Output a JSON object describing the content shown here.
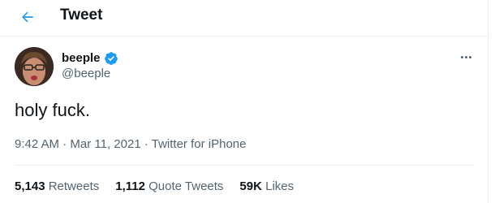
{
  "header": {
    "title": "Tweet",
    "back_icon": "arrow-left-icon"
  },
  "tweet": {
    "display_name": "beeple",
    "verified_icon": "verified-badge-icon",
    "handle": "@beeple",
    "text": "holy fuck.",
    "time": "9:42 AM",
    "separator": "·",
    "date": "Mar 11, 2021",
    "source": "Twitter for iPhone",
    "more_icon": "more-options-icon"
  },
  "stats": {
    "retweets_count": "5,143",
    "retweets_label": "Retweets",
    "quotes_count": "1,112",
    "quotes_label": "Quote Tweets",
    "likes_count": "59K",
    "likes_label": "Likes"
  },
  "colors": {
    "accent": "#1d9bf0",
    "text": "#0f1419",
    "secondary": "#536471",
    "border": "#ebeef0"
  }
}
